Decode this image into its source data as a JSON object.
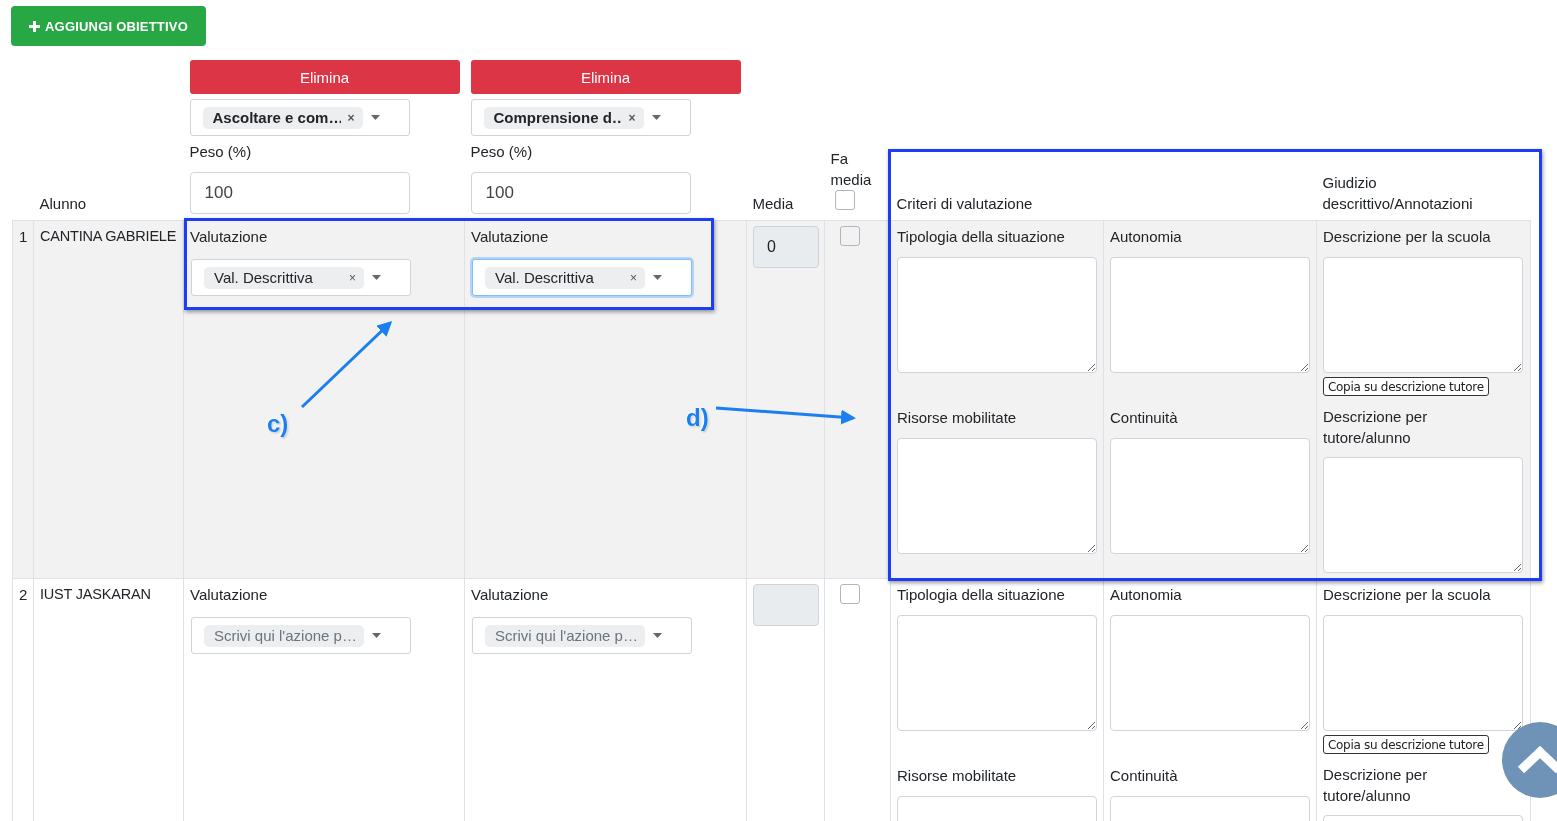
{
  "add_button": {
    "label": "AGGIUNGI OBIETTIVO"
  },
  "objectives": [
    {
      "delete_label": "Elimina",
      "tag": "Ascoltare e com…",
      "remove": "×",
      "weight_label": "Peso (%)",
      "weight": "100"
    },
    {
      "delete_label": "Elimina",
      "tag": "Comprensione d…",
      "remove": "×",
      "weight_label": "Peso (%)",
      "weight": "100"
    }
  ],
  "columns": {
    "student": "Alunno",
    "media": "Media",
    "fa_media": "Fa media",
    "fa_media_checked": false,
    "criteria": "Criteri di valutazione",
    "judgement": "Giudizio descrittivo/Annotazioni"
  },
  "rows": [
    {
      "index": "1",
      "name": "CANTINA GABRIELE",
      "highlighted": true,
      "evaluations": [
        {
          "label": "Valutazione",
          "value": "Val. Descrittiva",
          "remove": "×",
          "focused": false
        },
        {
          "label": "Valutazione",
          "value": "Val. Descrittiva",
          "remove": "×",
          "focused": true
        }
      ],
      "media": "0",
      "fa_media_checked": false,
      "criteria": [
        {
          "label": "Tipologia della situazione"
        },
        {
          "label": "Autonomia"
        },
        {
          "label": "Risorse mobilitate"
        },
        {
          "label": "Continuità"
        }
      ],
      "school_label": "Descrizione per la scuola",
      "copy_button": "Copia su descrizione tutore",
      "tutor_label": "Descrizione per tutore/alunno"
    },
    {
      "index": "2",
      "name": "IUST JASKARAN",
      "highlighted": false,
      "evaluations": [
        {
          "label": "Valutazione",
          "placeholder": "Scrivi qui l'azione p…",
          "focused": false
        },
        {
          "label": "Valutazione",
          "placeholder": "Scrivi qui l'azione p…",
          "focused": false
        }
      ],
      "fa_media_checked": false,
      "criteria": [
        {
          "label": "Tipologia della situazione"
        },
        {
          "label": "Autonomia"
        },
        {
          "label": "Risorse mobilitate"
        },
        {
          "label": "Continuità"
        }
      ],
      "school_label": "Descrizione per la scuola",
      "copy_button": "Copia su descrizione tutore",
      "tutor_label": "Descrizione per tutore/alunno"
    }
  ],
  "annotations": [
    {
      "label": "c)"
    },
    {
      "label": "d)"
    }
  ]
}
